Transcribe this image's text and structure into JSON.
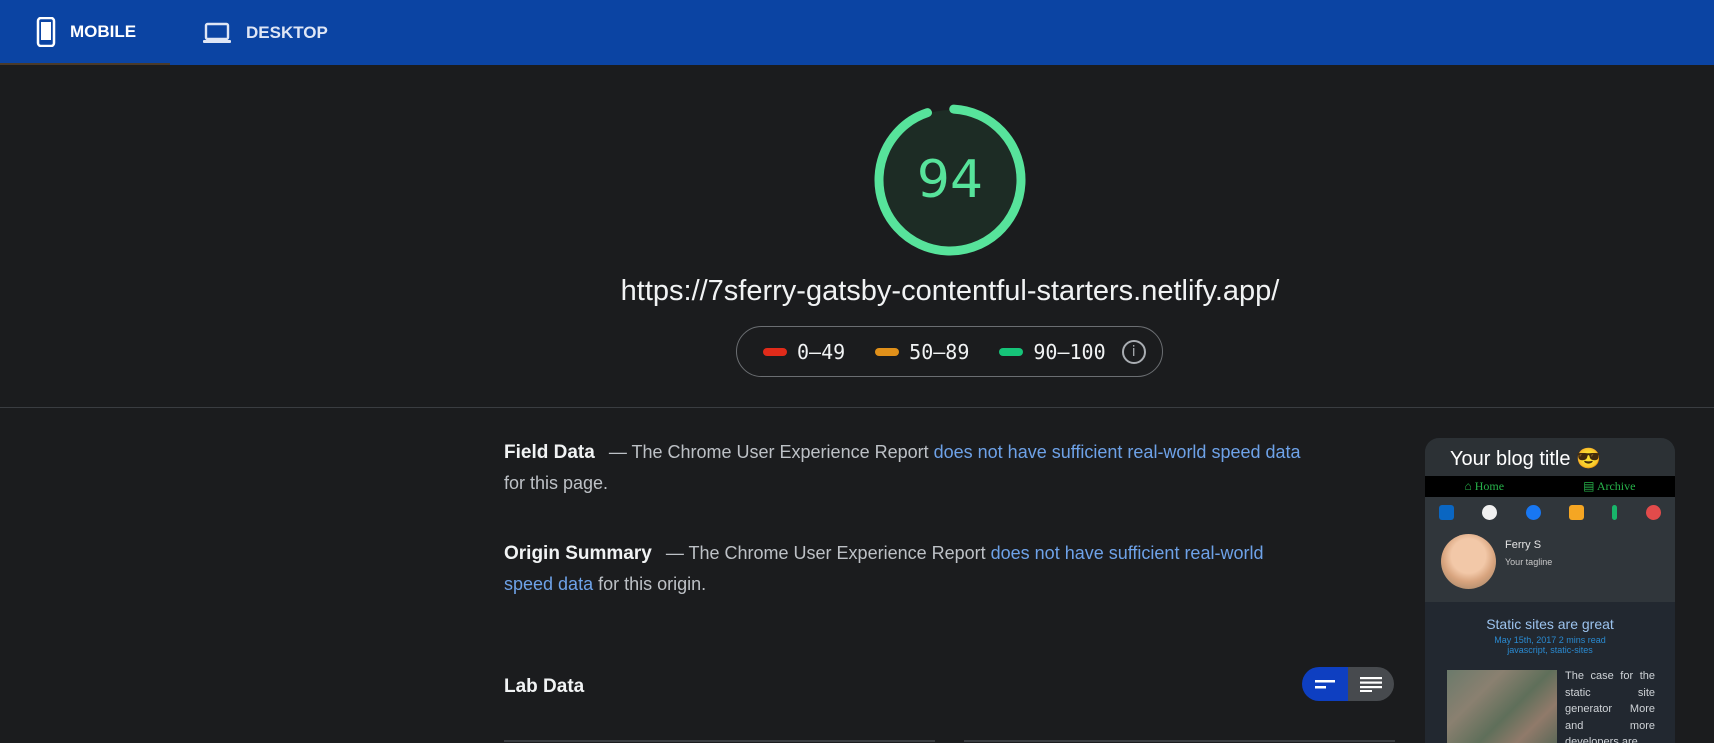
{
  "tabs": [
    {
      "label": "MOBILE",
      "icon": "smartphone-icon",
      "active": true
    },
    {
      "label": "DESKTOP",
      "icon": "laptop-icon",
      "active": false
    }
  ],
  "score": {
    "value": "94",
    "color": "#57e39b"
  },
  "url": "https://7sferry-gatsby-contentful-starters.netlify.app/",
  "legend": [
    {
      "range": "0–49",
      "color": "#e02b1a"
    },
    {
      "range": "50–89",
      "color": "#e0901a"
    },
    {
      "range": "90–100",
      "color": "#16c479"
    }
  ],
  "field_data": {
    "heading": "Field Data",
    "prefix": "— The Chrome User Experience Report ",
    "link": "does not have sufficient real-world speed data",
    "suffix": " for this page."
  },
  "origin_summary": {
    "heading": "Origin Summary",
    "prefix": "— The Chrome User Experience Report ",
    "link": "does not have sufficient real-world speed data",
    "suffix": " for this origin."
  },
  "lab_data": {
    "heading": "Lab Data"
  },
  "thumbnail": {
    "title": "Your blog title 😎",
    "nav": [
      "Home",
      "Archive"
    ],
    "name": "Ferry S",
    "tagline": "Your tagline",
    "post_title": "Static sites are great",
    "post_meta": "May 15th, 2017    2 mins read",
    "post_tags": "javascript, static-sites",
    "post_excerpt": "The case for the static site generator More and more developers are"
  }
}
